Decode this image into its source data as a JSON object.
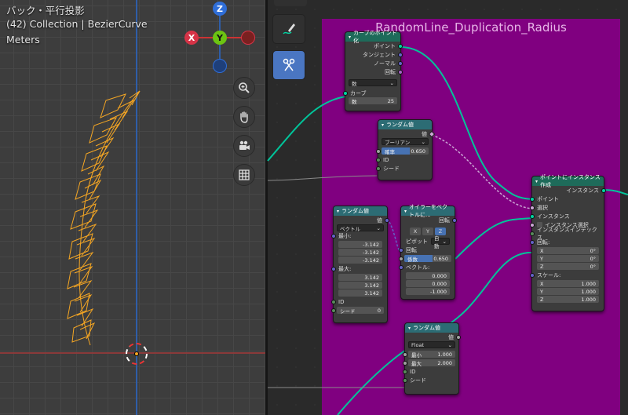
{
  "viewport": {
    "overlay_lines": [
      "バック・平行投影",
      "(42) Collection | BezierCurve",
      "Meters"
    ],
    "gizmo": {
      "x": "X",
      "y": "Y",
      "z": "Z"
    },
    "icons": [
      "zoom-icon",
      "hand-pan-icon",
      "camera-icon",
      "grid-icon"
    ]
  },
  "toolbar": {
    "tools": [
      "annotate-icon",
      "cut-links-icon"
    ]
  },
  "frame": {
    "title": "RandomLine_Duplication_Radius",
    "color": "#800080"
  },
  "nodes": {
    "curve_to_points": {
      "title": "カーブのポイント化",
      "outputs": [
        "ポイント",
        "タンジェント",
        "ノーマル",
        "回転"
      ],
      "mode": "数",
      "input_curve": "カーブ",
      "count_label": "数",
      "count_value": "25"
    },
    "random_bool": {
      "title": "ランダム値",
      "output": "値",
      "type": "ブーリアン",
      "prob_label": "確率",
      "prob_value": "0.650",
      "id_label": "ID",
      "seed_label": "シード"
    },
    "random_vec": {
      "title": "ランダム値",
      "output": "値",
      "type": "ベクトル",
      "min_label": "最小:",
      "min": [
        "-3.142",
        "-3.142",
        "-3.142"
      ],
      "max_label": "最大:",
      "max": [
        "3.142",
        "3.142",
        "3.142"
      ],
      "id_label": "ID",
      "seed_label": "シード",
      "seed_value": "0"
    },
    "euler_to_vec": {
      "title": "オイラーをベクトルに...",
      "output": "回転",
      "axes": [
        "X",
        "Y",
        "Z"
      ],
      "pivot_label": "ピボット",
      "pivot_value": "自動",
      "rot_label": "回転",
      "factor_label": "係数",
      "factor_value": "0.650",
      "vec_label": "ベクトル:",
      "vec": [
        "0.000",
        "0.000",
        "-1.000"
      ]
    },
    "instance_on_points": {
      "title": "ポイントにインスタンス作成",
      "output": "インスタンス",
      "inputs": [
        "ポイント",
        "選択",
        "インスタンス",
        "インスタンス選択",
        "インスタンスインデックス"
      ],
      "rot_label": "回転:",
      "rot": [
        [
          "X",
          "0°"
        ],
        [
          "Y",
          "0°"
        ],
        [
          "Z",
          "0°"
        ]
      ],
      "scale_label": "スケール:",
      "scale": [
        [
          "X",
          "1.000"
        ],
        [
          "Y",
          "1.000"
        ],
        [
          "Z",
          "1.000"
        ]
      ]
    },
    "random_float": {
      "title": "ランダム値",
      "output": "値",
      "type": "Float",
      "min_label": "最小",
      "min_value": "1.000",
      "max_label": "最大",
      "max_value": "2.000",
      "id_label": "ID",
      "seed_label": "シード"
    }
  }
}
